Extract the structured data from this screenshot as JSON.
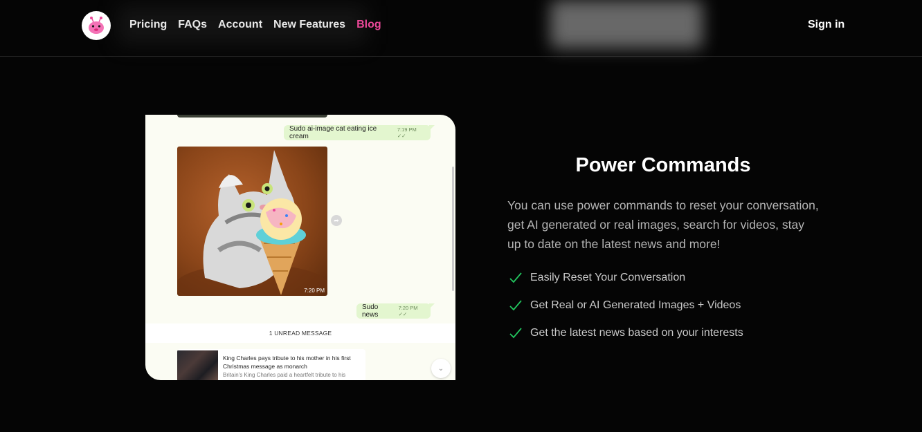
{
  "nav": {
    "links": [
      {
        "label": "Pricing"
      },
      {
        "label": "FAQs"
      },
      {
        "label": "Account"
      },
      {
        "label": "New Features"
      },
      {
        "label": "Blog"
      }
    ],
    "sign_in": "Sign in",
    "accent_color": "#ec4899"
  },
  "chat": {
    "message1": {
      "text": "Sudo ai-image cat eating ice cream",
      "time": "7:19 PM"
    },
    "image_time": "7:20 PM",
    "message2": {
      "text": "Sudo news",
      "time": "7:20 PM"
    },
    "unread_label": "1 UNREAD MESSAGE",
    "news": {
      "title": "King Charles pays tribute to his mother in his first Christmas message as monarch",
      "description": "Britain's King Charles paid a heartfelt tribute to his"
    }
  },
  "section": {
    "title": "Power Commands",
    "description": "You can use power commands to reset your conversation, get AI generated or real images, search for videos, stay up to date on the latest news and more!",
    "features": [
      "Easily Reset Your Conversation",
      "Get Real or AI Generated Images + Videos",
      "Get the latest news based on your interests"
    ],
    "check_color": "#22c55e"
  }
}
